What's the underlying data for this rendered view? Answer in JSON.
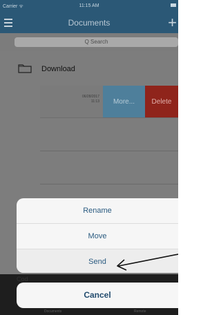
{
  "status_bar": {
    "carrier": "Carrier ᯤ",
    "time": "11:15 AM"
  },
  "nav": {
    "title": "Documents",
    "add_icon": "+"
  },
  "search": {
    "placeholder": "Q Search"
  },
  "list": {
    "folder": {
      "label": "Download"
    },
    "swipe_row": {
      "date": "06/28/2017",
      "time": "11:13",
      "more_label": "More...",
      "delete_label": "Delete"
    }
  },
  "action_sheet": {
    "items": [
      "Rename",
      "Move",
      "Send"
    ],
    "cancel": "Cancel"
  },
  "tab_bar": {
    "tabs": [
      "Documents",
      "Remote"
    ],
    "behind_text": "Cod"
  },
  "colors": {
    "nav_bar": "#2b5876",
    "more_button": "#4e7f9b",
    "delete_button": "#8f241b",
    "sheet_text": "#2b5b80"
  }
}
